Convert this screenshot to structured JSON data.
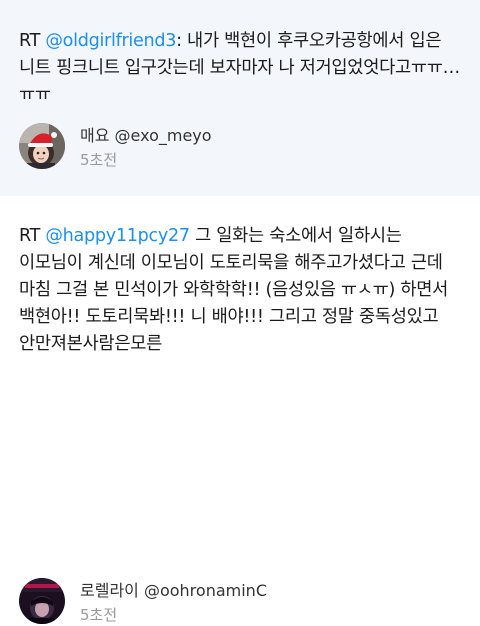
{
  "tweets": [
    {
      "prefix": "RT ",
      "mention": "@oldgirlfriend3",
      "body": ": 내가 백현이 후쿠오카공항에서 입은 니트 핑크니트 입구갓는데 보자마자 나 저거입었엇다고ㅠㅠ…ㅠㅠ",
      "author": "매요 @exo_meyo",
      "time": "5초전",
      "avatar_icon": "santa-hat-avatar-icon"
    },
    {
      "prefix": "RT ",
      "mention": "@happy11pcy27",
      "body": " 그 일화는 숙소에서 일하시는 이모님이 계신데 이모님이 도토리묵을 해주고가셨다고 근데 마침 그걸 본 민석이가 와학학학!! (음성있음 ㅠㅅㅠ) 하면서 백현아!! 도토리묵봐!!! 니 배야!!! 그리고 정말 중독성있고 안만져본사람은모른",
      "author": "로렐라이 @oohronaminC",
      "time": "5초전",
      "avatar_icon": "dark-portrait-avatar-icon"
    }
  ],
  "colors": {
    "mention": "#1d8ff0",
    "first_background": "#f3f6fa",
    "second_background": "#ffffff",
    "text": "#1c1c1c",
    "time": "#9a9a9a"
  }
}
